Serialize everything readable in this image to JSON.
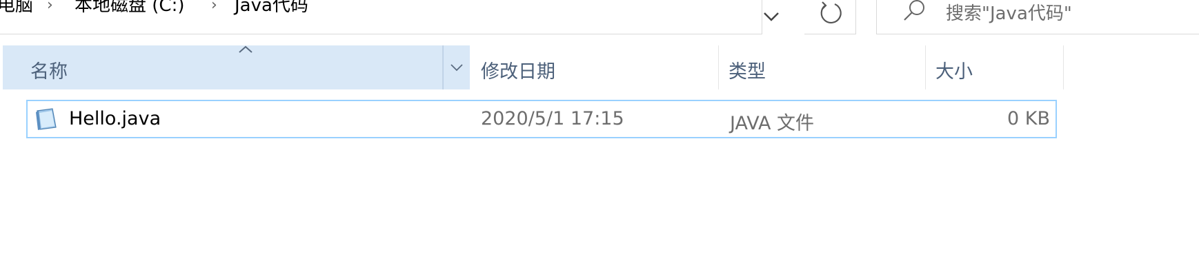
{
  "breadcrumb": {
    "items": [
      "电脑",
      "本地磁盘 (C:)",
      "Java代码"
    ]
  },
  "search": {
    "placeholder": "搜索\"Java代码\""
  },
  "columns": {
    "name": "名称",
    "date": "修改日期",
    "type": "类型",
    "size": "大小"
  },
  "sort": {
    "column": "名称",
    "direction": "ascending"
  },
  "files": [
    {
      "name": "Hello.java",
      "modified": "2020/5/1 17:15",
      "type": "JAVA 文件",
      "size": "0 KB",
      "icon": "java-file-icon",
      "selected": true
    }
  ],
  "colors": {
    "header_selected_bg": "#d9e8f7",
    "row_selected_border": "#99d1ff",
    "header_text": "#4c607a",
    "secondary_text": "#6d6d6d"
  }
}
